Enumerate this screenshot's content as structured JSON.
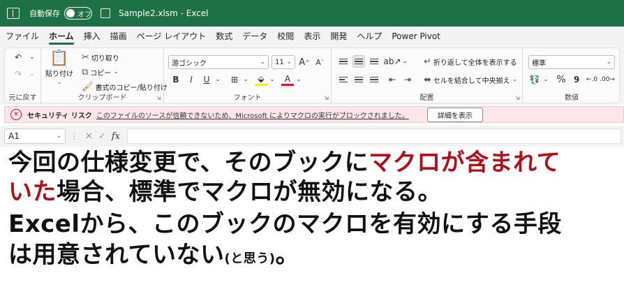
{
  "titlebar": {
    "autosave_label": "自動保存",
    "toggle_label": "オフ",
    "title": "Sample2.xlsm  -  Excel"
  },
  "tabs": [
    "ファイル",
    "ホーム",
    "挿入",
    "描画",
    "ページ レイアウト",
    "数式",
    "データ",
    "校閲",
    "表示",
    "開発",
    "ヘルプ",
    "Power Pivot"
  ],
  "active_tab": "ホーム",
  "ribbon": {
    "undo": {
      "label": "元に戻す"
    },
    "clipboard": {
      "label": "クリップボード",
      "paste": "貼り付け",
      "cut": "切り取り",
      "copy": "コピー",
      "format_painter": "書式のコピー/貼り付け"
    },
    "font": {
      "label": "フォント",
      "font_name": "游ゴシック",
      "font_size": "11",
      "bold": "B",
      "italic": "I",
      "underline": "U",
      "grow": "A",
      "shrink": "A"
    },
    "alignment": {
      "label": "配置",
      "wrap_text": "折り返して全体を表示する",
      "merge_center": "セルを結合して中央揃え"
    },
    "number": {
      "label": "数値",
      "format": "標準",
      "percent": "%",
      "comma": "9"
    }
  },
  "security_bar": {
    "title": "セキュリティ リスク",
    "message": "このファイルのソースが信頼できないため、Microsoft によりマクロの実行がブロックされました。",
    "button": "詳細を表示"
  },
  "formula_bar": {
    "name_box": "A1",
    "fx": "fx"
  },
  "overlay": {
    "line1_a": "今回の仕様変更で、そのブックに",
    "line1_b": "マクロが含まれて",
    "line2_a": "いた",
    "line2_b": "場合、標準でマクロが無効になる。",
    "line3": "Excelから、このブックのマクロを有効にする手段",
    "line4_a": "は用意されていない",
    "line4_b": "(と思う)",
    "line4_c": "。"
  },
  "colors": {
    "title_bar": "#1e7145",
    "highlight_text": "#b0101a",
    "security_bar": "#fde7e9"
  }
}
